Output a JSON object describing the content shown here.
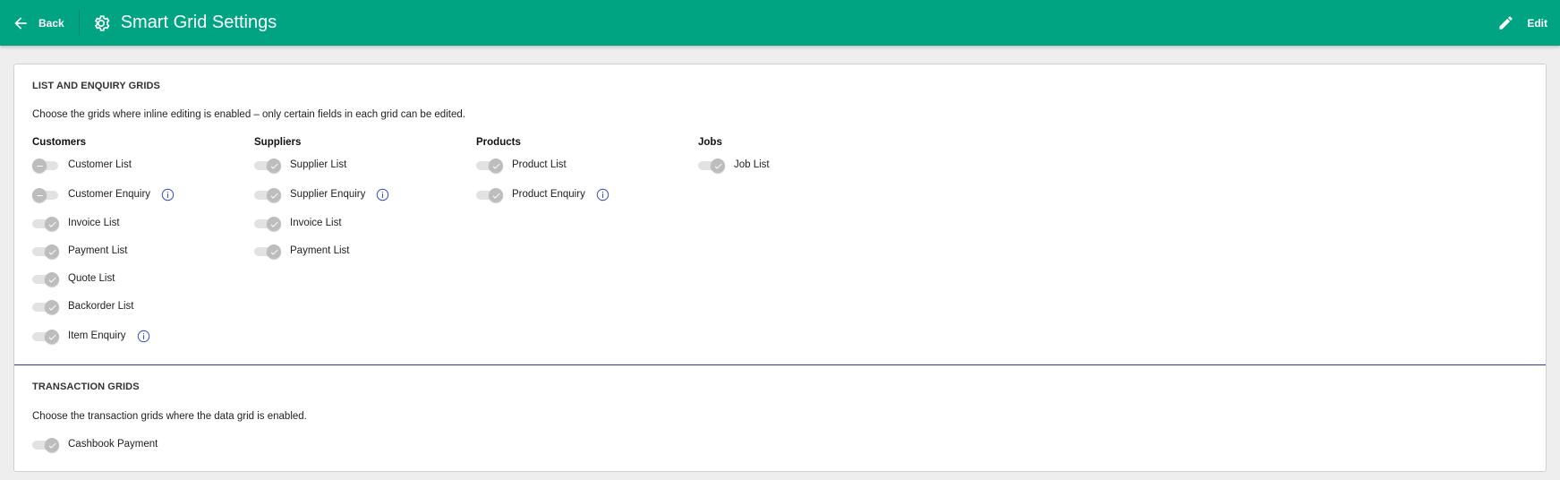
{
  "header": {
    "back_label": "Back",
    "title": "Smart Grid Settings",
    "edit_label": "Edit",
    "accent_color": "#00a382"
  },
  "list_section": {
    "title": "LIST AND ENQUIRY GRIDS",
    "description": "Choose the grids where inline editing is enabled – only certain fields in each grid can be edited.",
    "columns": [
      {
        "heading": "Customers",
        "items": [
          {
            "label": "Customer List",
            "enabled": false,
            "info": false
          },
          {
            "label": "Customer Enquiry",
            "enabled": false,
            "info": true
          },
          {
            "label": "Invoice List",
            "enabled": true,
            "info": false
          },
          {
            "label": "Payment List",
            "enabled": true,
            "info": false
          },
          {
            "label": "Quote List",
            "enabled": true,
            "info": false
          },
          {
            "label": "Backorder List",
            "enabled": true,
            "info": false
          },
          {
            "label": "Item Enquiry",
            "enabled": true,
            "info": true
          }
        ]
      },
      {
        "heading": "Suppliers",
        "items": [
          {
            "label": "Supplier List",
            "enabled": true,
            "info": false
          },
          {
            "label": "Supplier Enquiry",
            "enabled": true,
            "info": true
          },
          {
            "label": "Invoice List",
            "enabled": true,
            "info": false
          },
          {
            "label": "Payment List",
            "enabled": true,
            "info": false
          }
        ]
      },
      {
        "heading": "Products",
        "items": [
          {
            "label": "Product List",
            "enabled": true,
            "info": false
          },
          {
            "label": "Product Enquiry",
            "enabled": true,
            "info": true
          }
        ]
      },
      {
        "heading": "Jobs",
        "items": [
          {
            "label": "Job List",
            "enabled": true,
            "info": false
          }
        ]
      }
    ]
  },
  "transaction_section": {
    "title": "TRANSACTION GRIDS",
    "description": "Choose the transaction grids where the data grid is enabled.",
    "items": [
      {
        "label": "Cashbook Payment",
        "enabled": true,
        "info": false
      }
    ]
  }
}
